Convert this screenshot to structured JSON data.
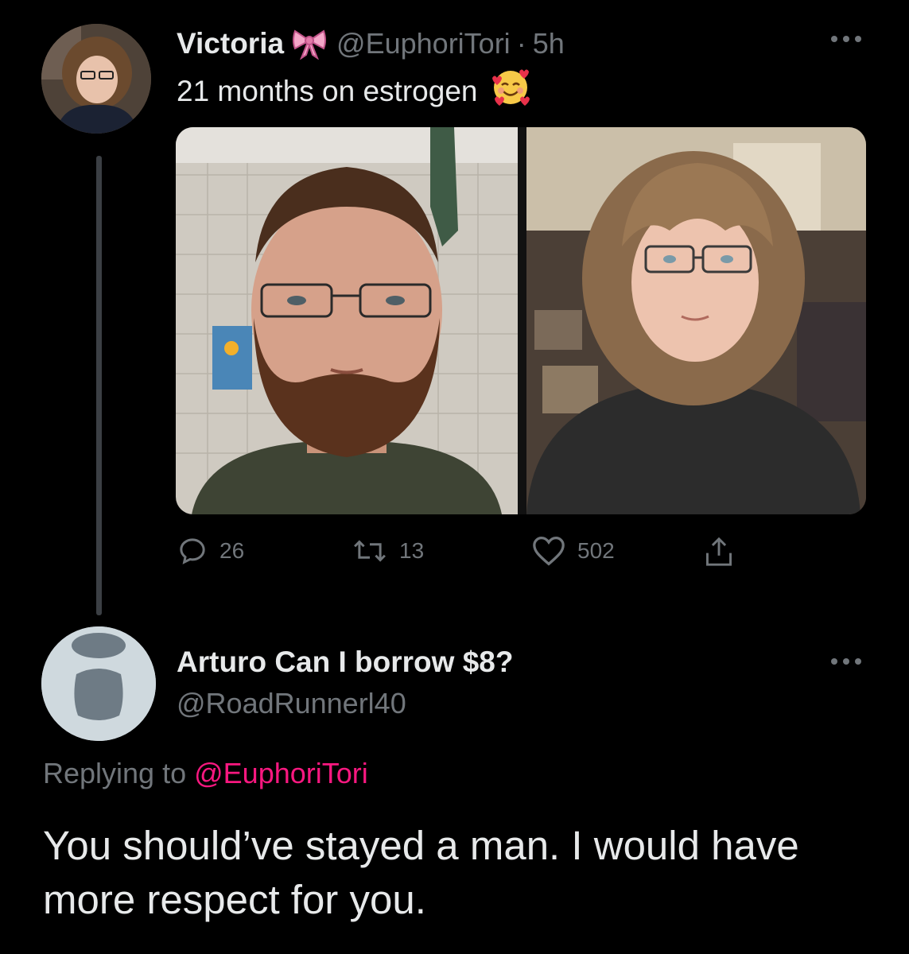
{
  "tweet": {
    "display_name": "Victoria",
    "name_emoji": "ribbon-bow-icon",
    "handle": "@EuphoriTori",
    "separator": "·",
    "time": "5h",
    "text": "21 months on estrogen",
    "text_emoji": "smiling-face-with-hearts-icon",
    "media": [
      {
        "description": "before-photo"
      },
      {
        "description": "after-photo"
      }
    ],
    "actions": {
      "replies": "26",
      "retweets": "13",
      "likes": "502"
    }
  },
  "reply": {
    "display_name": "Arturo Can I borrow $8?",
    "handle": "@RoadRunnerl40",
    "replying_prefix": "Replying to",
    "replying_to": "@EuphoriTori",
    "text": "You should’ve stayed a man. I would have more respect for you."
  },
  "colors": {
    "background": "#000000",
    "primary_text": "#e7e9ea",
    "secondary_text": "#71767b",
    "mention": "#f91880",
    "thread_line": "#3b3f44"
  }
}
